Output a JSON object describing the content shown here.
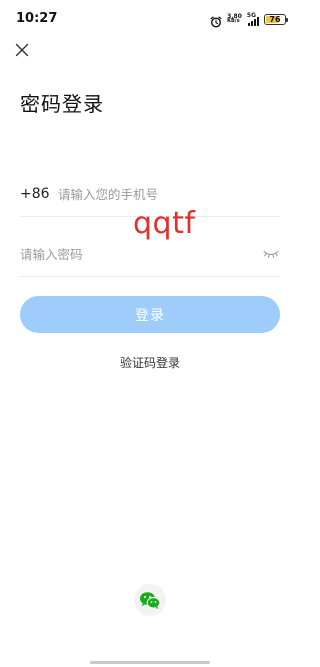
{
  "status_bar": {
    "time": "10:27",
    "network_speed_value": "3.80",
    "network_speed_unit": "KB/s",
    "network_type": "5G",
    "battery_percent": "76",
    "battery_level": 0.76,
    "battery_color": "#f2c935"
  },
  "header": {
    "close_icon": "close-icon"
  },
  "page": {
    "title": "密码登录"
  },
  "form": {
    "country_code": "+86",
    "phone_placeholder": "请输入您的手机号",
    "phone_value": "",
    "password_placeholder": "请输入密码",
    "password_value": "",
    "password_toggle_icon": "eye-closed-icon",
    "login_label": "登录",
    "login_color": "#9fcdfb",
    "alt_login_label": "验证码登录"
  },
  "watermark": {
    "text": "qqtf",
    "color": "#e0312f"
  },
  "third_party": {
    "wechat_icon": "wechat-icon",
    "wechat_color": "#1aad19"
  }
}
